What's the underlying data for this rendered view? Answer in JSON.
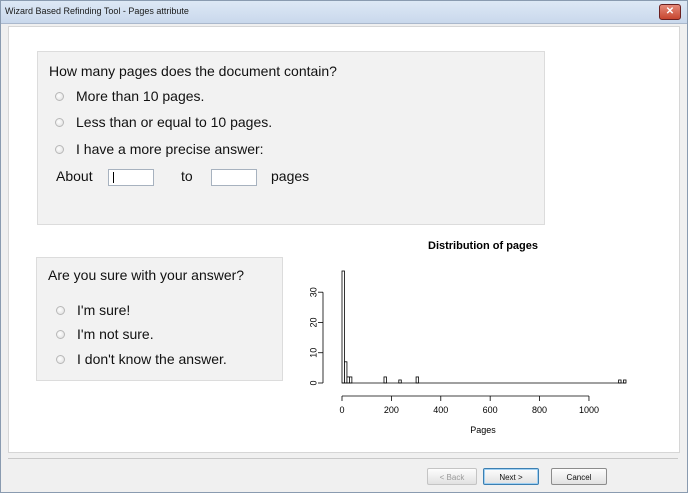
{
  "window": {
    "title": "Wizard Based Refinding Tool - Pages attribute",
    "close_glyph": "✕"
  },
  "pages_question": {
    "question": "How many pages does the document contain?",
    "options": [
      "More than 10 pages.",
      "Less than or equal to 10 pages.",
      "I have a more precise answer:"
    ],
    "about_label": "About",
    "to_label": "to",
    "pages_label": "pages",
    "from_value": "",
    "to_value": ""
  },
  "confidence_question": {
    "question": "Are you sure with your answer?",
    "options": [
      "I'm sure!",
      "I'm not sure.",
      "I don't know the answer."
    ]
  },
  "buttons": {
    "back": "< Back",
    "next": "Next >",
    "cancel": "Cancel"
  },
  "chart_data": {
    "type": "bar",
    "title": "Distribution of pages",
    "xlabel": "Pages",
    "ylabel": "",
    "xlim": [
      0,
      1150
    ],
    "ylim": [
      0,
      37
    ],
    "x_ticks": [
      0,
      200,
      400,
      600,
      800,
      1000
    ],
    "y_ticks": [
      0,
      10,
      20,
      30
    ],
    "bin_width": 10,
    "bins": [
      {
        "start": 0,
        "count": 37
      },
      {
        "start": 10,
        "count": 7
      },
      {
        "start": 20,
        "count": 2
      },
      {
        "start": 30,
        "count": 2
      },
      {
        "start": 170,
        "count": 2
      },
      {
        "start": 230,
        "count": 1
      },
      {
        "start": 300,
        "count": 2
      },
      {
        "start": 1120,
        "count": 1
      },
      {
        "start": 1140,
        "count": 1
      }
    ]
  }
}
